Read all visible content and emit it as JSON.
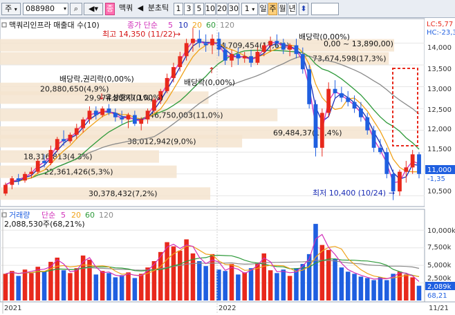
{
  "toolbar": {
    "mode": "주",
    "code": "088980",
    "name_badge": "종",
    "name": "맥쿼",
    "period_label": "분초틱",
    "intervals": [
      "1",
      "3",
      "5",
      "10",
      "20",
      "30"
    ],
    "count": "1",
    "day": "일",
    "week": "주",
    "month": "월",
    "year": "년"
  },
  "price_panel": {
    "title": "맥쿼리인프라 매출대 수(10)",
    "ma_label": "종가 단순",
    "ma_periods": [
      "5",
      "10",
      "20",
      "60",
      "120"
    ],
    "lc_label": "LC:5,77",
    "hc_label": "HC:-23,3",
    "current_price": "11,000",
    "change": "-1,35",
    "y_ticks": [
      "14,000",
      "13,500",
      "13,000",
      "12,500",
      "12,000",
      "11,500",
      "10,500"
    ],
    "high_label": "최고 14,350 (11/22)",
    "low_label": "최저 10,400 (10/24)",
    "annotations": {
      "dividend1": "배당락(0,00%)",
      "dividend2": "배당락(0,00%)",
      "dividend_rights": "배당락,권리락(0,00%)",
      "paid_increase": "유상증자(0,00%)",
      "range": "0,00 ~ 13,890,00)"
    },
    "volume_profile": [
      {
        "label": "14,709,454(17,6%)"
      },
      {
        "label": "73,674,598(17,3%)"
      },
      {
        "label": "20,880,650(4,9%)"
      },
      {
        "label": "29,974,800(7,1%)"
      },
      {
        "label": "46,750,003(11,0%)"
      },
      {
        "label": "69,484,37(16,4%)"
      },
      {
        "label": "38,012,942(9,0%)"
      },
      {
        "label": "18,316,813(4,3%)"
      },
      {
        "label": "22,361,426(5,3%)"
      },
      {
        "label": "30,378,432(7,2%)"
      }
    ]
  },
  "volume_panel": {
    "title": "거래량",
    "ma_label": "단순",
    "ma_periods": [
      "5",
      "20",
      "60",
      "120"
    ],
    "current": "2,088,530주(68,21%)",
    "y_ticks": [
      "10,000k",
      "7,500k",
      "5,000k",
      "2,500k"
    ],
    "current_badge": "2,089k",
    "pct_badge": "68,21"
  },
  "x_axis": {
    "labels": [
      "2021",
      "2022",
      "11/21"
    ]
  },
  "chart_data": {
    "type": "candlestick",
    "price_axis": {
      "ylim": [
        10300,
        14450
      ]
    },
    "volume_axis": {
      "ylim": [
        0,
        11500
      ]
    },
    "x_ticks": [
      "2021",
      "2022"
    ],
    "candles": [
      {
        "o": 10550,
        "h": 10800,
        "l": 10500,
        "c": 10750
      },
      {
        "o": 10750,
        "h": 10950,
        "l": 10650,
        "c": 10900
      },
      {
        "o": 10900,
        "h": 11000,
        "l": 10750,
        "c": 10850
      },
      {
        "o": 10850,
        "h": 11050,
        "l": 10800,
        "c": 11000
      },
      {
        "o": 11000,
        "h": 11150,
        "l": 10900,
        "c": 11050
      },
      {
        "o": 11050,
        "h": 11350,
        "l": 11000,
        "c": 11300
      },
      {
        "o": 11300,
        "h": 11450,
        "l": 11150,
        "c": 11250
      },
      {
        "o": 11250,
        "h": 11650,
        "l": 11200,
        "c": 11550
      },
      {
        "o": 11550,
        "h": 11850,
        "l": 11500,
        "c": 11800
      },
      {
        "o": 11800,
        "h": 12000,
        "l": 11650,
        "c": 11750
      },
      {
        "o": 11750,
        "h": 11950,
        "l": 11700,
        "c": 11900
      },
      {
        "o": 11900,
        "h": 12150,
        "l": 11800,
        "c": 12050
      },
      {
        "o": 12050,
        "h": 12300,
        "l": 11950,
        "c": 12250
      },
      {
        "o": 12250,
        "h": 12550,
        "l": 12150,
        "c": 12450
      },
      {
        "o": 12450,
        "h": 12550,
        "l": 12250,
        "c": 12350
      },
      {
        "o": 12350,
        "h": 12550,
        "l": 12300,
        "c": 12500
      },
      {
        "o": 12500,
        "h": 12600,
        "l": 12350,
        "c": 12400
      },
      {
        "o": 12400,
        "h": 12500,
        "l": 12200,
        "c": 12300
      },
      {
        "o": 12300,
        "h": 12450,
        "l": 12150,
        "c": 12250
      },
      {
        "o": 12250,
        "h": 12400,
        "l": 12050,
        "c": 12350
      },
      {
        "o": 12350,
        "h": 12450,
        "l": 12100,
        "c": 12150
      },
      {
        "o": 12150,
        "h": 12300,
        "l": 12000,
        "c": 12250
      },
      {
        "o": 12250,
        "h": 12500,
        "l": 12150,
        "c": 12450
      },
      {
        "o": 12450,
        "h": 12750,
        "l": 12400,
        "c": 12700
      },
      {
        "o": 12700,
        "h": 12950,
        "l": 12600,
        "c": 12900
      },
      {
        "o": 12900,
        "h": 13300,
        "l": 12850,
        "c": 13200
      },
      {
        "o": 13200,
        "h": 13550,
        "l": 13100,
        "c": 13450
      },
      {
        "o": 13450,
        "h": 13800,
        "l": 13350,
        "c": 13700
      },
      {
        "o": 13700,
        "h": 14100,
        "l": 13600,
        "c": 14000
      },
      {
        "o": 14000,
        "h": 14350,
        "l": 13800,
        "c": 14100
      },
      {
        "o": 14100,
        "h": 14300,
        "l": 13900,
        "c": 14000
      },
      {
        "o": 14000,
        "h": 14200,
        "l": 13800,
        "c": 13950
      },
      {
        "o": 13950,
        "h": 14200,
        "l": 13750,
        "c": 14100
      },
      {
        "o": 14100,
        "h": 14250,
        "l": 13700,
        "c": 13850
      },
      {
        "o": 13850,
        "h": 14000,
        "l": 13500,
        "c": 13600
      },
      {
        "o": 13600,
        "h": 13850,
        "l": 13450,
        "c": 13750
      },
      {
        "o": 13750,
        "h": 13900,
        "l": 13500,
        "c": 13650
      },
      {
        "o": 13650,
        "h": 13800,
        "l": 13550,
        "c": 13700
      },
      {
        "o": 13700,
        "h": 13850,
        "l": 13450,
        "c": 13550
      },
      {
        "o": 13550,
        "h": 13900,
        "l": 13500,
        "c": 13800
      },
      {
        "o": 13800,
        "h": 14000,
        "l": 13700,
        "c": 13950
      },
      {
        "o": 13950,
        "h": 14150,
        "l": 13800,
        "c": 14050
      },
      {
        "o": 14050,
        "h": 14200,
        "l": 13900,
        "c": 14000
      },
      {
        "o": 14000,
        "h": 14100,
        "l": 13750,
        "c": 13850
      },
      {
        "o": 13850,
        "h": 14000,
        "l": 13700,
        "c": 13950
      },
      {
        "o": 13950,
        "h": 14100,
        "l": 13650,
        "c": 13750
      },
      {
        "o": 13750,
        "h": 13900,
        "l": 13300,
        "c": 13400
      },
      {
        "o": 13400,
        "h": 13500,
        "l": 12500,
        "c": 12600
      },
      {
        "o": 12600,
        "h": 12700,
        "l": 11400,
        "c": 11600
      },
      {
        "o": 11600,
        "h": 12500,
        "l": 11400,
        "c": 12400
      },
      {
        "o": 12400,
        "h": 13100,
        "l": 12300,
        "c": 12950
      },
      {
        "o": 12950,
        "h": 13150,
        "l": 12750,
        "c": 12850
      },
      {
        "o": 12850,
        "h": 13000,
        "l": 12650,
        "c": 12750
      },
      {
        "o": 12750,
        "h": 12900,
        "l": 12550,
        "c": 12650
      },
      {
        "o": 12650,
        "h": 12800,
        "l": 12400,
        "c": 12500
      },
      {
        "o": 12500,
        "h": 12650,
        "l": 12200,
        "c": 12300
      },
      {
        "o": 12300,
        "h": 12400,
        "l": 11900,
        "c": 12000
      },
      {
        "o": 12000,
        "h": 12100,
        "l": 11500,
        "c": 11600
      },
      {
        "o": 11600,
        "h": 11800,
        "l": 11450,
        "c": 11500
      },
      {
        "o": 11500,
        "h": 11600,
        "l": 10900,
        "c": 11000
      },
      {
        "o": 11000,
        "h": 11100,
        "l": 10400,
        "c": 10600
      },
      {
        "o": 10600,
        "h": 11100,
        "l": 10500,
        "c": 11050
      },
      {
        "o": 11050,
        "h": 11300,
        "l": 10800,
        "c": 11150
      },
      {
        "o": 11150,
        "h": 11550,
        "l": 11000,
        "c": 11450
      },
      {
        "o": 11450,
        "h": 11500,
        "l": 10900,
        "c": 11000
      }
    ],
    "volumes": [
      3800,
      4200,
      3500,
      4400,
      3900,
      4800,
      4100,
      5500,
      6100,
      4300,
      3900,
      4600,
      6400,
      5800,
      3700,
      4200,
      3900,
      3300,
      3600,
      4000,
      3200,
      3800,
      4700,
      5600,
      6900,
      8300,
      7700,
      7100,
      8700,
      6700,
      5600,
      4900,
      6600,
      4400,
      4200,
      5200,
      3700,
      4000,
      4600,
      5400,
      6700,
      4300,
      3900,
      4400,
      3500,
      4600,
      5200,
      6600,
      10900,
      7900,
      7200,
      5900,
      4700,
      4100,
      3800,
      3400,
      3200,
      2900,
      3300,
      2900,
      3800,
      4100,
      3700,
      3300,
      2100
    ],
    "volume_profile_values": [
      14709454,
      73674598,
      20880650,
      29974800,
      46750003,
      69484370,
      38012942,
      18316813,
      22361426,
      30378432
    ],
    "volume_profile_pct": [
      17.6,
      17.3,
      4.9,
      7.1,
      11.0,
      16.4,
      9.0,
      4.3,
      5.3,
      7.2
    ]
  },
  "colors": {
    "up": "#e8291c",
    "down": "#1f5fe0",
    "ma5": "#d12fb9",
    "ma10": "#1a2cb5",
    "ma20": "#f0a21a",
    "ma60": "#2e9a3a",
    "ma120": "#8a8a8a",
    "profile": "#f4e4cf",
    "grid": "#e6e6e6"
  }
}
